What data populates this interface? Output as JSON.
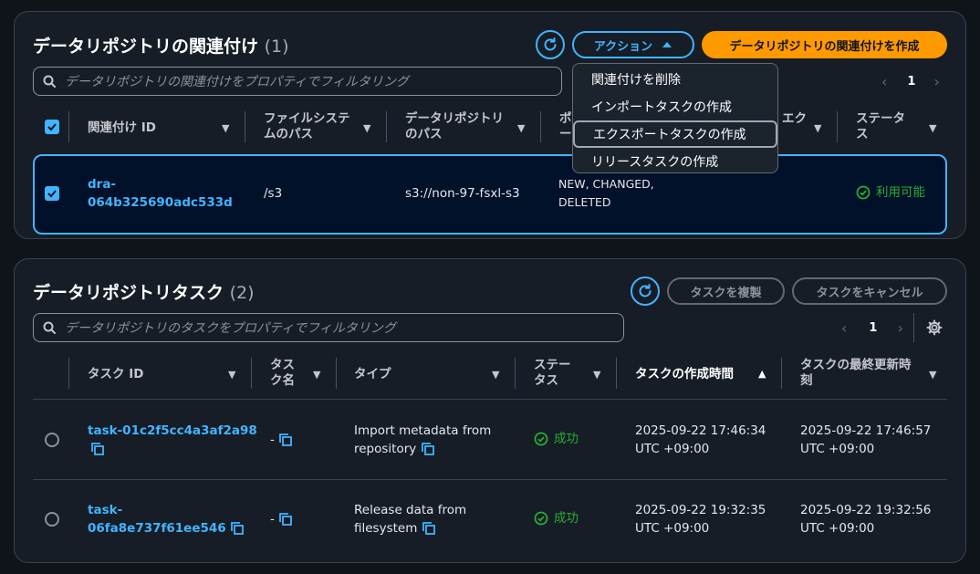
{
  "assoc": {
    "title": "データリポジトリの関連付け",
    "count": "(1)",
    "actions_label": "アクション",
    "create_label": "データリポジトリの関連付けを作成",
    "search_placeholder": "データリポジトリの関連付けをプロパティでフィルタリング",
    "page": "1",
    "columns": {
      "id": "関連付け ID",
      "fs_path_1": "ファイルシステ",
      "fs_path_2": "ムのパス",
      "repo_path_1": "データリポジトリ",
      "repo_path_2": "のパス",
      "policy_1": "ポ",
      "policy_2": "ー",
      "export_1": "エク",
      "status_1": "ステータ",
      "status_2": "ス"
    },
    "row": {
      "id_1": "dra-",
      "id_2": "064b325690adc533d",
      "fs_path": "/s3",
      "repo_path": "s3://non-97-fsxl-s3",
      "events_1": "NEW, CHANGED,",
      "events_2": "DELETED",
      "status": "利用可能"
    },
    "menu": [
      "関連付けを削除",
      "インポートタスクの作成",
      "エクスポートタスクの作成",
      "リリースタスクの作成"
    ]
  },
  "tasks": {
    "title": "データリポジトリタスク",
    "count": "(2)",
    "copy_label": "タスクを複製",
    "cancel_label": "タスクをキャンセル",
    "search_placeholder": "データリポジトリのタスクをプロパティでフィルタリング",
    "page": "1",
    "columns": {
      "id": "タスク ID",
      "name_1": "タス",
      "name_2": "ク名",
      "type": "タイプ",
      "status_1": "ステー",
      "status_2": "タス",
      "created": "タスクの作成時間",
      "updated_1": "タスクの最終更新時",
      "updated_2": "刻"
    },
    "rows": [
      {
        "id_1": "task-01c2f5cc4a3af2a98",
        "id_2": "",
        "name": "-",
        "type_1": "Import metadata from",
        "type_2": "repository",
        "status": "成功",
        "created_1": "2025-09-22 17:46:34",
        "created_2": "UTC +09:00",
        "updated_1": "2025-09-22 17:46:57",
        "updated_2": "UTC +09:00"
      },
      {
        "id_1": "task-",
        "id_2": "06fa8e737f61ee546",
        "name": "-",
        "type_1": "Release data from",
        "type_2": "filesystem",
        "status": "成功",
        "created_1": "2025-09-22 19:32:35",
        "created_2": "UTC +09:00",
        "updated_1": "2025-09-22 19:32:56",
        "updated_2": "UTC +09:00"
      }
    ]
  },
  "colors": {
    "accent": "#42b4ff",
    "primary": "#ff9900",
    "success": "#29ad32",
    "background": "#0f141a",
    "panel": "#161d26"
  }
}
